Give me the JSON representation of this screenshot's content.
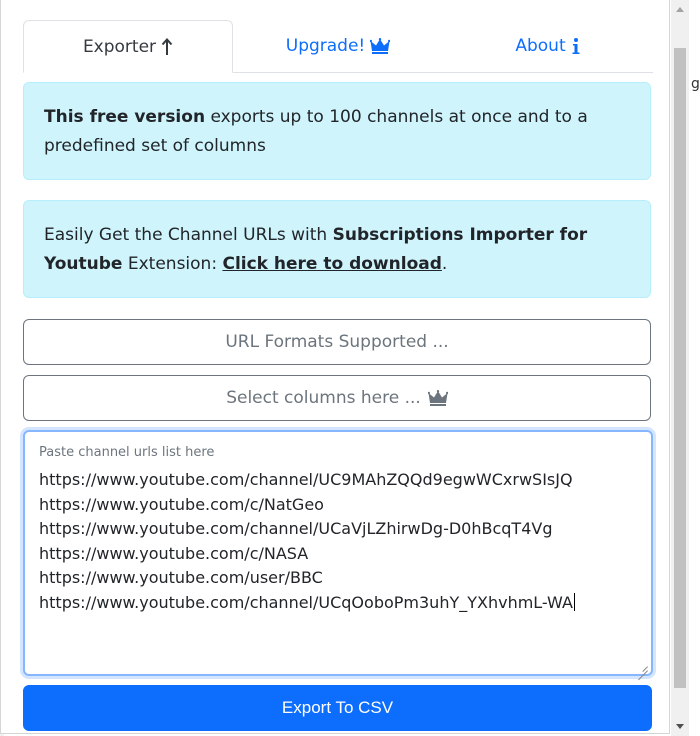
{
  "tabs": [
    {
      "label": "Exporter",
      "icon": "arrow-up-icon"
    },
    {
      "label": "Upgrade!",
      "icon": "crown-icon"
    },
    {
      "label": "About",
      "icon": "info-icon"
    }
  ],
  "alerts": {
    "free_bold": "This free version",
    "free_text": " exports up to 100 channels at once and to a predefined set of columns",
    "import_text_1": "Easily Get the Channel URLs with ",
    "import_bold": "Subscriptions Importer for Youtube",
    "import_text_2": " Extension: ",
    "import_link": "Click here to download",
    "import_text_3": "."
  },
  "buttons": {
    "formats": "URL Formats Supported ...",
    "columns": "Select columns here ...",
    "export": "Export To CSV"
  },
  "textarea": {
    "placeholder": "Paste channel urls list here",
    "lines": [
      "https://www.youtube.com/channel/UC9MAhZQQd9egwWCxrwSIsJQ",
      "https://www.youtube.com/c/NatGeo",
      "https://www.youtube.com/channel/UCaVjLZhirwDg-D0hBcqT4Vg",
      "https://www.youtube.com/c/NASA",
      "https://www.youtube.com/user/BBC",
      "https://www.youtube.com/channel/UCqOoboPm3uhY_YXhvhmL-WA"
    ]
  },
  "background_page": {
    "edge_char": "g"
  },
  "colors": {
    "primary": "#0d6efd",
    "alert_bg": "#cff4fc",
    "outline_gray": "#6c757d"
  }
}
